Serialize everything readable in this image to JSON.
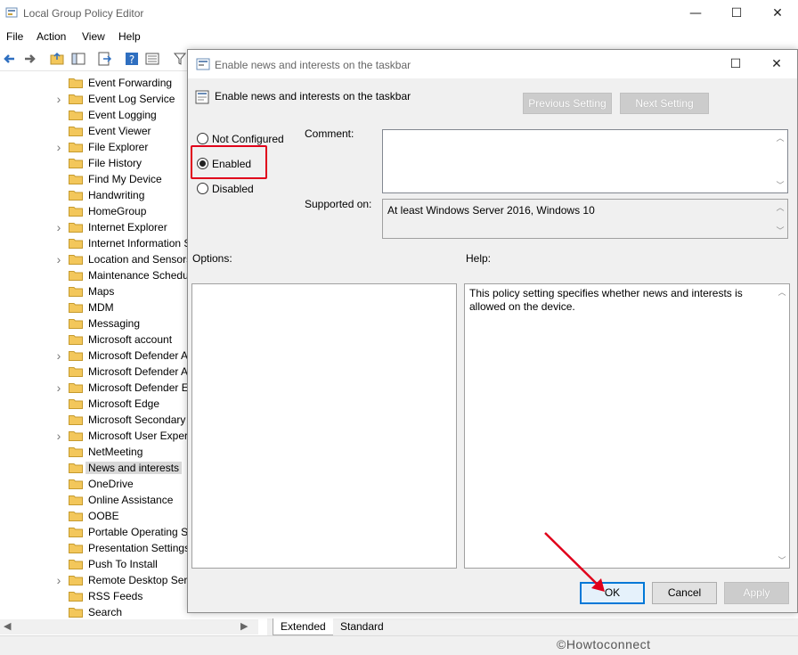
{
  "main_window": {
    "title": "Local Group Policy Editor",
    "controls": {
      "minimize": "—",
      "maximize": "☐",
      "close": "✕"
    }
  },
  "menu": [
    "File",
    "Action",
    "View",
    "Help"
  ],
  "tree": {
    "items": [
      {
        "label": "Event Forwarding",
        "expandable": false
      },
      {
        "label": "Event Log Service",
        "expandable": true
      },
      {
        "label": "Event Logging",
        "expandable": false
      },
      {
        "label": "Event Viewer",
        "expandable": false
      },
      {
        "label": "File Explorer",
        "expandable": true
      },
      {
        "label": "File History",
        "expandable": false
      },
      {
        "label": "Find My Device",
        "expandable": false
      },
      {
        "label": "Handwriting",
        "expandable": false
      },
      {
        "label": "HomeGroup",
        "expandable": false
      },
      {
        "label": "Internet Explorer",
        "expandable": true
      },
      {
        "label": "Internet Information S",
        "expandable": false
      },
      {
        "label": "Location and Sensors",
        "expandable": true
      },
      {
        "label": "Maintenance Schedu",
        "expandable": false
      },
      {
        "label": "Maps",
        "expandable": false
      },
      {
        "label": "MDM",
        "expandable": false
      },
      {
        "label": "Messaging",
        "expandable": false
      },
      {
        "label": "Microsoft account",
        "expandable": false
      },
      {
        "label": "Microsoft Defender A",
        "expandable": true
      },
      {
        "label": "Microsoft Defender A",
        "expandable": false
      },
      {
        "label": "Microsoft Defender E",
        "expandable": true
      },
      {
        "label": "Microsoft Edge",
        "expandable": false
      },
      {
        "label": "Microsoft Secondary",
        "expandable": false
      },
      {
        "label": "Microsoft User Experi",
        "expandable": true
      },
      {
        "label": "NetMeeting",
        "expandable": false
      },
      {
        "label": "News and interests",
        "expandable": false,
        "selected": true
      },
      {
        "label": "OneDrive",
        "expandable": false
      },
      {
        "label": "Online Assistance",
        "expandable": false
      },
      {
        "label": "OOBE",
        "expandable": false
      },
      {
        "label": "Portable Operating Sy",
        "expandable": false
      },
      {
        "label": "Presentation Settings",
        "expandable": false
      },
      {
        "label": "Push To Install",
        "expandable": false
      },
      {
        "label": "Remote Desktop Serv",
        "expandable": true
      },
      {
        "label": "RSS Feeds",
        "expandable": false
      },
      {
        "label": "Search",
        "expandable": false
      }
    ]
  },
  "tabs": [
    "Extended",
    "Standard"
  ],
  "watermark": "©Howtoconnect",
  "dialog": {
    "title": "Enable news and interests on the taskbar",
    "header": "Enable news and interests on the taskbar",
    "previous_setting": "Previous Setting",
    "next_setting": "Next Setting",
    "radios": {
      "not_configured": "Not Configured",
      "enabled": "Enabled",
      "disabled": "Disabled",
      "selected": "enabled"
    },
    "comment_label": "Comment:",
    "comment_value": "",
    "supported_label": "Supported on:",
    "supported_value": "At least Windows Server 2016, Windows 10",
    "options_label": "Options:",
    "help_label": "Help:",
    "help_text": "This policy setting specifies whether news and interests is allowed on the device.",
    "ok": "OK",
    "cancel": "Cancel",
    "apply": "Apply",
    "controls": {
      "maximize": "☐",
      "close": "✕"
    }
  },
  "colors": {
    "highlight_box": "#e0001b",
    "ok_border": "#0078d7",
    "folder": "#f3c75b"
  }
}
